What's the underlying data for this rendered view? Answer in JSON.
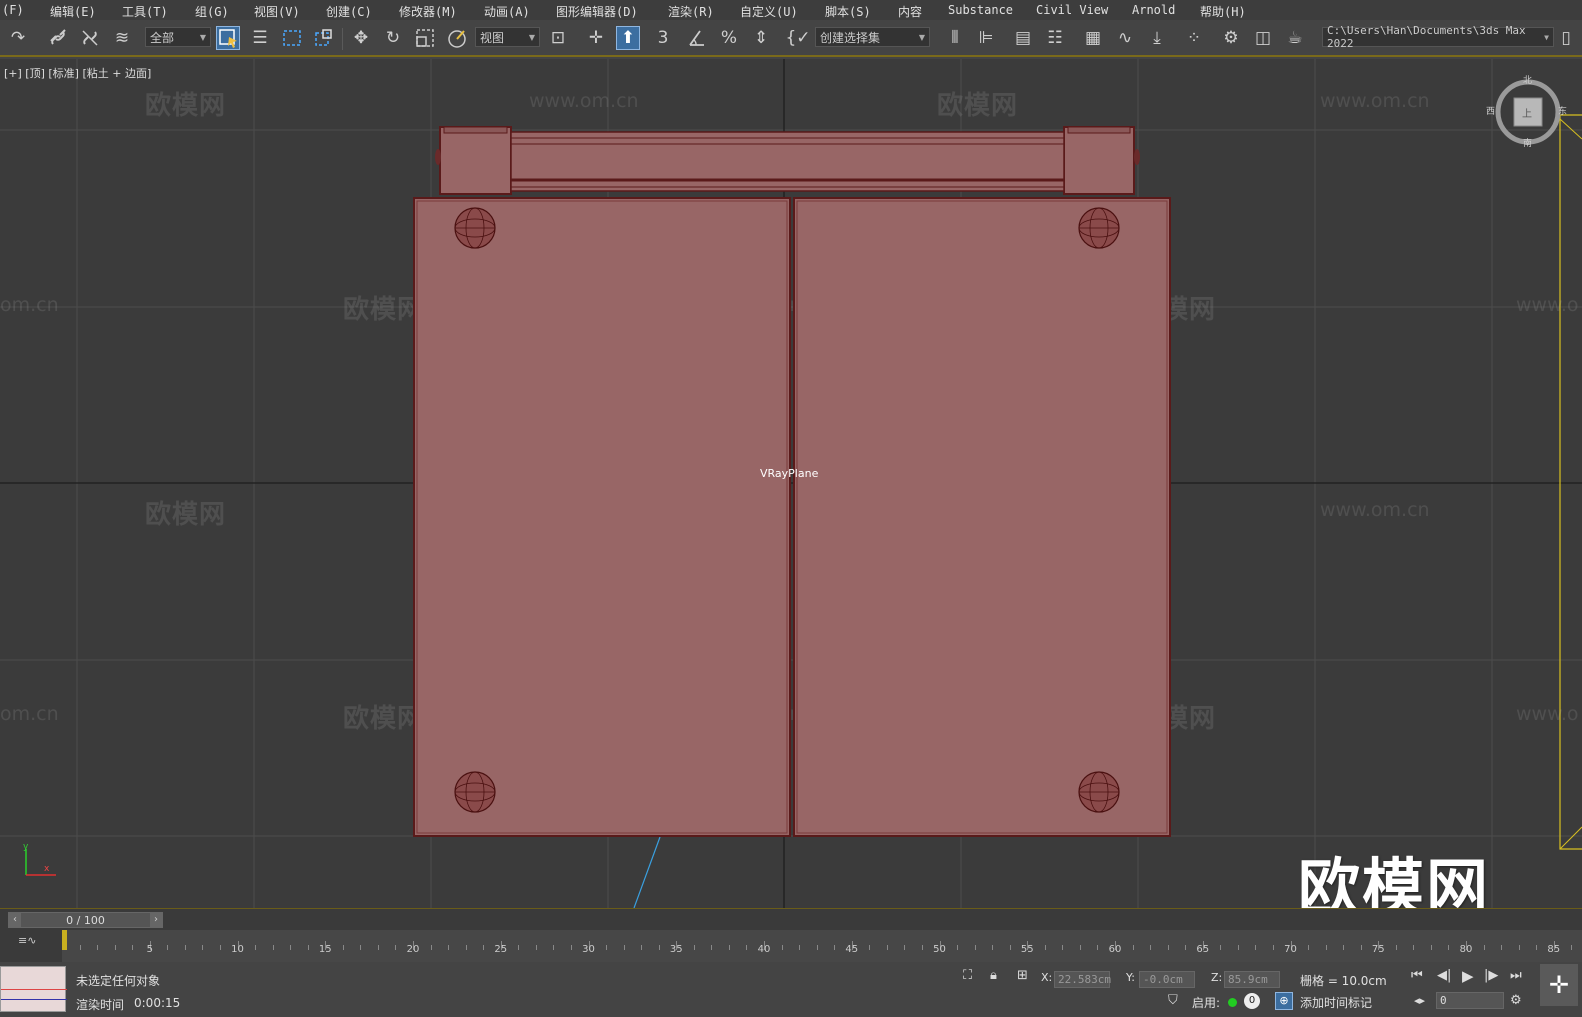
{
  "menu": {
    "items": [
      "(F)",
      "编辑(E)",
      "工具(T)",
      "组(G)",
      "视图(V)",
      "创建(C)",
      "修改器(M)",
      "动画(A)",
      "图形编辑器(D)",
      "渲染(R)",
      "自定义(U)",
      "脚本(S)",
      "内容",
      "Substance",
      "Civil View",
      "Arnold",
      "帮助(H)"
    ]
  },
  "toolbar": {
    "selection_filter": "全部",
    "coordinate_system": "视图",
    "named_selection": "创建选择集",
    "project_path": "C:\\Users\\Han\\Documents\\3ds Max 2022"
  },
  "viewport": {
    "label": "[+] [顶] [标准] [粘土 + 边面]",
    "object_label": "VRayPlane",
    "viewcube": {
      "top": "上",
      "north": "北",
      "south": "南",
      "west": "西",
      "east": "东"
    },
    "watermark_cn": "欧模网",
    "watermark_url": "www.om.cn",
    "watermark_url_partial": "om.cn",
    "watermark_url_partial_right": "www.o",
    "axis_x": "x",
    "axis_y": "y"
  },
  "brand_watermark": "欧模网",
  "time_slider": {
    "value": "0 / 100"
  },
  "timeline": {
    "labels": [
      "5",
      "10",
      "15",
      "20",
      "25",
      "30",
      "35",
      "40",
      "45",
      "50",
      "55",
      "60",
      "65",
      "70",
      "75",
      "80",
      "85"
    ]
  },
  "status": {
    "selection": "未选定任何对象",
    "render_time_label": "渲染时间",
    "render_time_value": "0:00:15",
    "x_label": "X:",
    "x_value": "22.583cm",
    "y_label": "Y:",
    "y_value": "-0.0cm",
    "z_label": "Z:",
    "z_value": "85.9cm",
    "grid": "栅格 = 10.0cm",
    "enable_label": "启用:",
    "enable_count": "0",
    "add_time_tag": "添加时间标记",
    "frame_value": "0"
  },
  "colors": {
    "object_fill": "#986666",
    "object_edge": "#5a1a1a",
    "viewport_bg": "#3b3b3b",
    "accent_active": "#3c6ea0"
  }
}
